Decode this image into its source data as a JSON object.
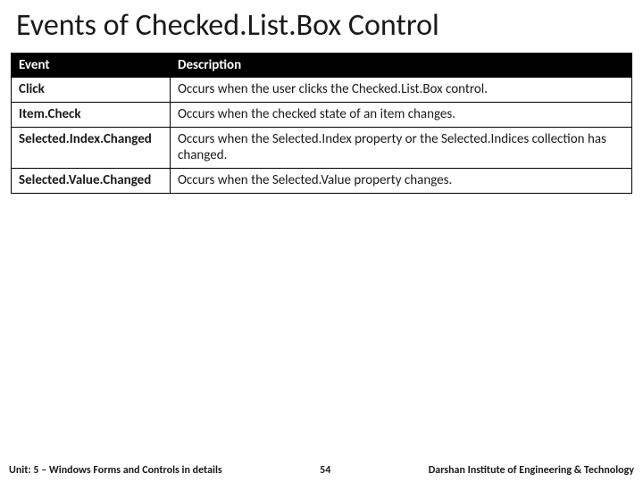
{
  "title": "Events of Checked.List.Box Control",
  "table": {
    "headers": {
      "event": "Event",
      "desc": "Description"
    },
    "rows": [
      {
        "event": "Click",
        "desc": "Occurs when the user clicks the Checked.List.Box control."
      },
      {
        "event": "Item.Check",
        "desc": "Occurs when the checked state of an item changes."
      },
      {
        "event": "Selected.Index.Changed",
        "desc": "Occurs when the Selected.Index property or the Selected.Indices collection has changed."
      },
      {
        "event": "Selected.Value.Changed",
        "desc": "Occurs when the Selected.Value property changes."
      }
    ]
  },
  "footer": {
    "unit": "Unit: 5 – Windows Forms and Controls in details",
    "page": "54",
    "org": "Darshan Institute of Engineering & Technology"
  }
}
